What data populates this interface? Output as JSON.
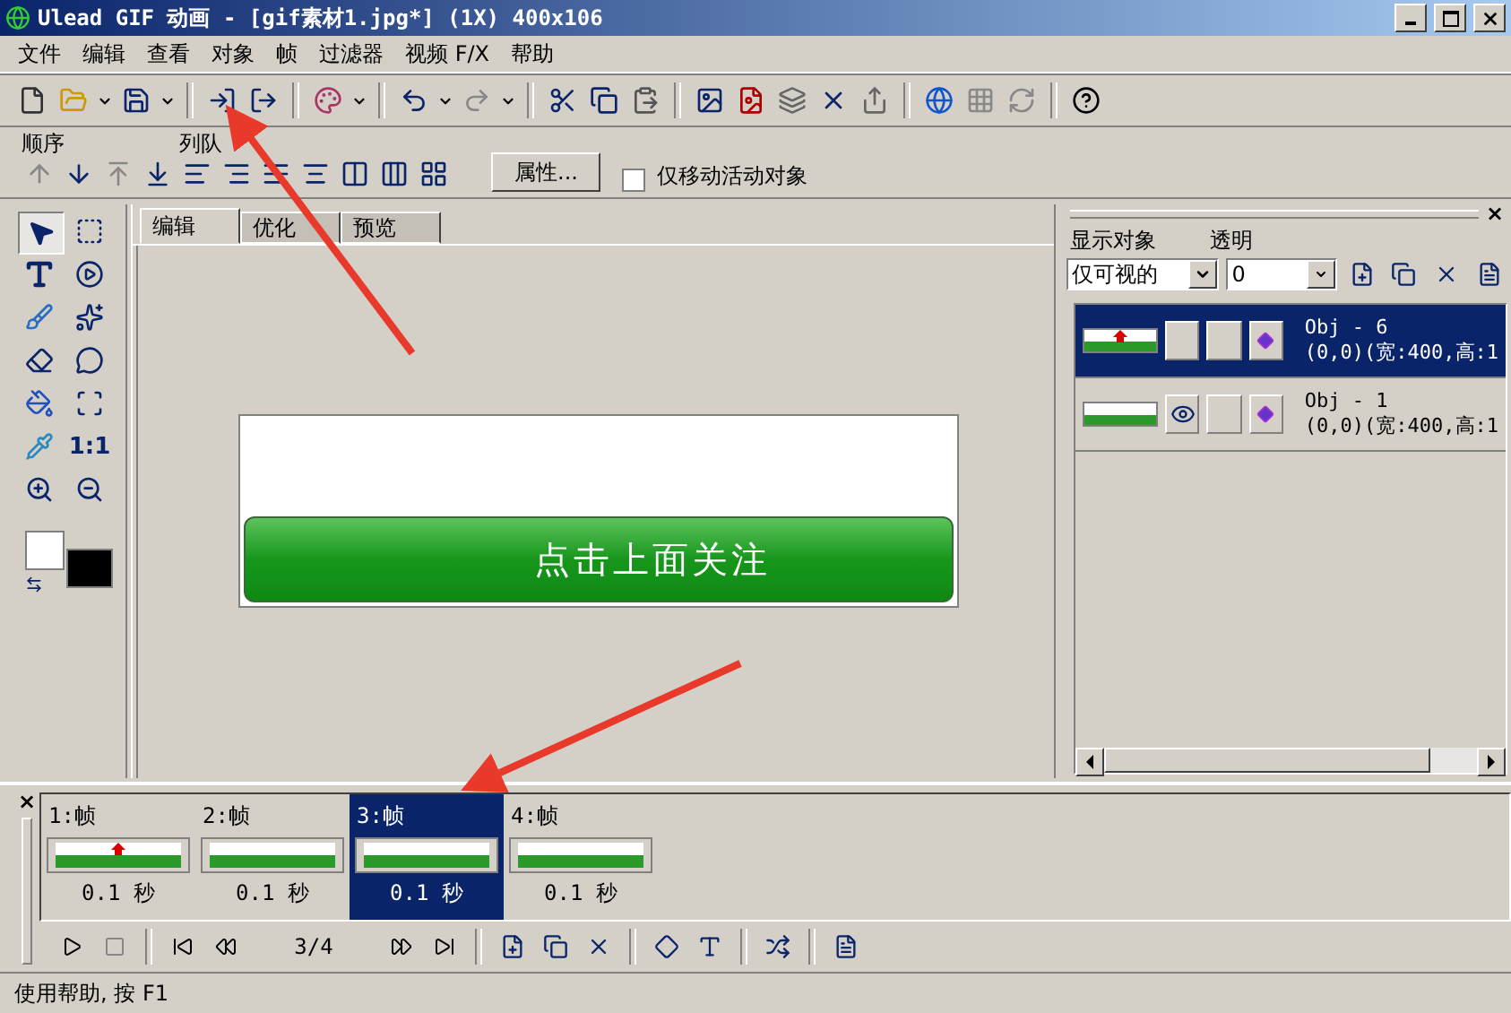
{
  "window": {
    "title": "Ulead GIF 动画 - [gif素材1.jpg*] (1X) 400x106"
  },
  "menu": [
    "文件",
    "编辑",
    "查看",
    "对象",
    "帧",
    "过滤器",
    "视频 F/X",
    "帮助"
  ],
  "arrange_bar": {
    "order_label": "顺序",
    "align_label": "列队",
    "properties_button": "属性...",
    "move_active_only": {
      "label": "仅移动活动对象",
      "checked": false
    }
  },
  "tool_palette": {
    "actual_size_label": "1:1"
  },
  "editor": {
    "tabs": [
      {
        "label": "编辑",
        "selected": true
      },
      {
        "label": "优化",
        "selected": false
      },
      {
        "label": "预览",
        "selected": false
      }
    ],
    "canvas": {
      "banner_text": "点击上面关注"
    }
  },
  "object_manager": {
    "close": "×",
    "show_label": "显示对象",
    "show_value": "仅可视的",
    "transparency_label": "透明",
    "transparency_value": "0",
    "objects": [
      {
        "name": "Obj - 6",
        "details": "(0,0)(宽:400,高:1",
        "selected": true,
        "visible": false,
        "has_marker": true
      },
      {
        "name": "Obj - 1",
        "details": "(0,0)(宽:400,高:1",
        "selected": false,
        "visible": true,
        "has_marker": false
      }
    ]
  },
  "frame_panel": {
    "close": "×",
    "frames": [
      {
        "label": "1:帧",
        "delay": "0.1 秒",
        "selected": false,
        "has_marker": true
      },
      {
        "label": "2:帧",
        "delay": "0.1 秒",
        "selected": false,
        "has_marker": false
      },
      {
        "label": "3:帧",
        "delay": "0.1 秒",
        "selected": true,
        "has_marker": false
      },
      {
        "label": "4:帧",
        "delay": "0.1 秒",
        "selected": false,
        "has_marker": false
      }
    ],
    "counter": "3/4"
  },
  "status_bar": "使用帮助, 按 F1",
  "annotations": [
    {
      "kind": "arrow"
    },
    {
      "kind": "arrow"
    }
  ]
}
